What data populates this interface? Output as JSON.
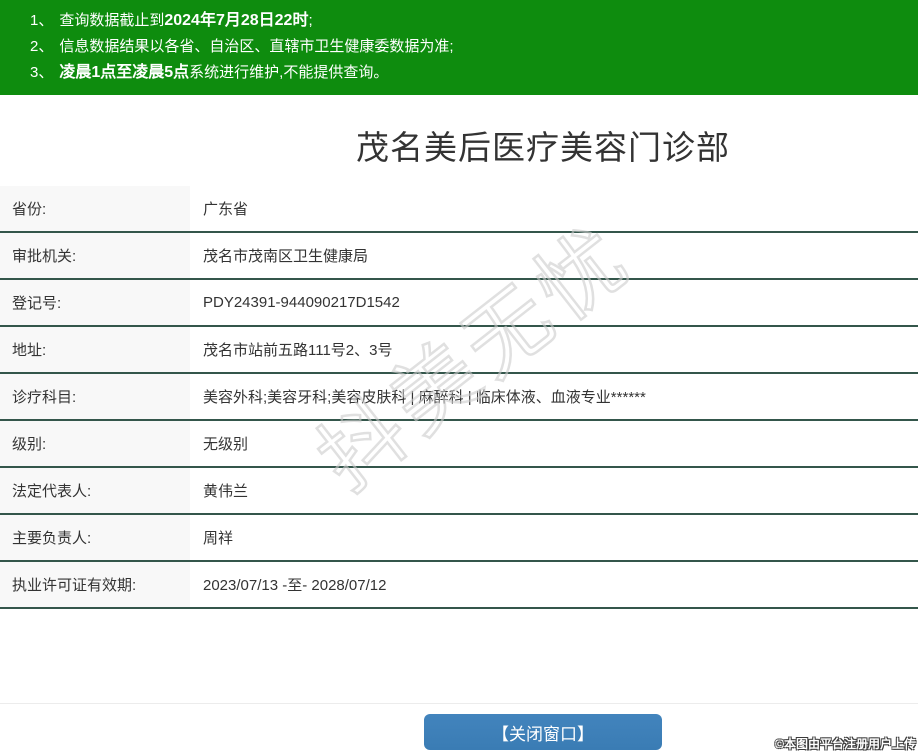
{
  "notice_bar": {
    "bg_color": "#0e8c0e",
    "items": [
      {
        "num": "1、",
        "pre": "查询数据截止到",
        "bold": "2024年7月28日22时",
        "post": ";"
      },
      {
        "num": "2、",
        "pre": "信息数据结果以各省、自治区、直辖市卫生健康委数据为准;",
        "bold": "",
        "post": ""
      },
      {
        "num": "3、",
        "pre": "",
        "bold": "凌晨1点至凌晨5点",
        "post": "系统进行维护,不能提供查询。"
      }
    ]
  },
  "title": "茂名美后医疗美容门诊部",
  "records": [
    {
      "label": "省份:",
      "value": "广东省"
    },
    {
      "label": "审批机关:",
      "value": "茂名市茂南区卫生健康局"
    },
    {
      "label": "登记号:",
      "value": "PDY24391-944090217D1542"
    },
    {
      "label": "地址:",
      "value": "茂名市站前五路111号2、3号"
    },
    {
      "label": "诊疗科目:",
      "value": "美容外科;美容牙科;美容皮肤科 | 麻醉科 | 临床体液、血液专业******"
    },
    {
      "label": "级别:",
      "value": "无级别"
    },
    {
      "label": "法定代表人:",
      "value": "黄伟兰"
    },
    {
      "label": "主要负责人:",
      "value": "周祥"
    },
    {
      "label": "执业许可证有效期:",
      "value": "2023/07/13 -至- 2028/07/12"
    }
  ],
  "watermarks": {
    "diagonal": "抖美无忧",
    "copyright": "©本图由平台注册用户上传"
  },
  "footer": {
    "close_button_label": "【关闭窗口】",
    "button_color": "#3a7cb4"
  },
  "colors": {
    "header_green": "#0e8c0e",
    "row_divider": "#34564b",
    "label_cell_bg": "#f8f8f8",
    "watermark_gray": "#cccccc"
  }
}
